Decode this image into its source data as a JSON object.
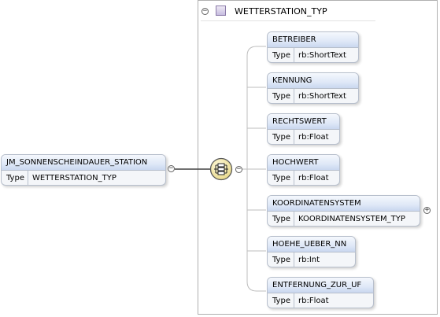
{
  "type_box": {
    "title": "WETTERSTATION_TYP"
  },
  "root": {
    "name": "JM_SONNENSCHEINDAUER_STATION",
    "type_label": "Type",
    "type_value": "WETTERSTATION_TYP"
  },
  "collapse_glyph": "−",
  "expand_glyph": "+",
  "fields": [
    {
      "name": "BETREIBER",
      "type_label": "Type",
      "type_value": "rb:ShortText"
    },
    {
      "name": "KENNUNG",
      "type_label": "Type",
      "type_value": "rb:ShortText"
    },
    {
      "name": "RECHTSWERT",
      "type_label": "Type",
      "type_value": "rb:Float"
    },
    {
      "name": "HOCHWERT",
      "type_label": "Type",
      "type_value": "rb:Float"
    },
    {
      "name": "KOORDINATENSYSTEM",
      "type_label": "Type",
      "type_value": "KOORDINATENSYSTEM_TYP"
    },
    {
      "name": "HOEHE_UEBER_NN",
      "type_label": "Type",
      "type_value": "rb:Int"
    },
    {
      "name": "ENTFERNUNG_ZUR_UF",
      "type_label": "Type",
      "type_value": "rb:Float"
    }
  ],
  "icons": {
    "type_icon": "complex-type-icon",
    "sequence_icon": "sequence-compositor-icon"
  }
}
